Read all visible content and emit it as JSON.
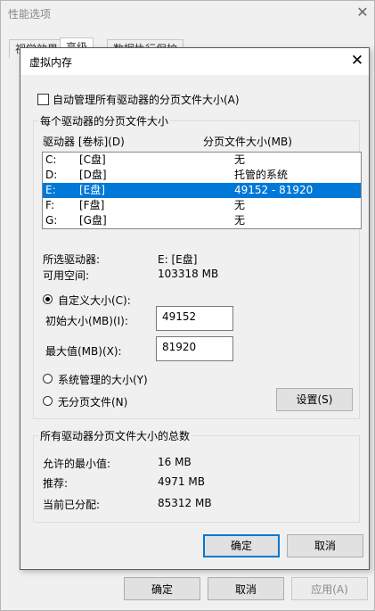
{
  "bg_window": {
    "title": "性能选项",
    "tabs": [
      "视觉效果",
      "高级",
      "数据执行保护"
    ],
    "buttons": {
      "ok": "确定",
      "cancel": "取消",
      "apply": "应用(A)"
    }
  },
  "dialog": {
    "title": "虚拟内存",
    "auto_manage_label": "自动管理所有驱动器的分页文件大小(A)",
    "auto_manage_checked": false,
    "per_drive_group_label": "每个驱动器的分页文件大小",
    "col_drive": "驱动器 [卷标](D)",
    "col_size": "分页文件大小(MB)",
    "drives": [
      {
        "letter": "C:",
        "label": "[C盘]",
        "size": "无",
        "selected": false
      },
      {
        "letter": "D:",
        "label": "[D盘]",
        "size": "托管的系统",
        "selected": false
      },
      {
        "letter": "E:",
        "label": "[E盘]",
        "size": "49152 - 81920",
        "selected": true
      },
      {
        "letter": "F:",
        "label": "[F盘]",
        "size": "无",
        "selected": false
      },
      {
        "letter": "G:",
        "label": "[G盘]",
        "size": "无",
        "selected": false
      }
    ],
    "selected_drive_label": "所选驱动器:",
    "selected_drive_value": "E:  [E盘]",
    "free_space_label": "可用空间:",
    "free_space_value": "103318 MB",
    "custom_size_label": "自定义大小(C):",
    "initial_size_label": "初始大小(MB)(I):",
    "initial_size_value": "49152",
    "max_size_label": "最大值(MB)(X):",
    "max_size_value": "81920",
    "system_managed_label": "系统管理的大小(Y)",
    "no_paging_label": "无分页文件(N)",
    "set_button": "设置(S)",
    "total_group_label": "所有驱动器分页文件大小的总数",
    "min_allowed_label": "允许的最小值:",
    "min_allowed_value": "16 MB",
    "recommended_label": "推荐:",
    "recommended_value": "4971 MB",
    "allocated_label": "当前已分配:",
    "allocated_value": "85312 MB",
    "ok_button": "确定",
    "cancel_button": "取消"
  }
}
